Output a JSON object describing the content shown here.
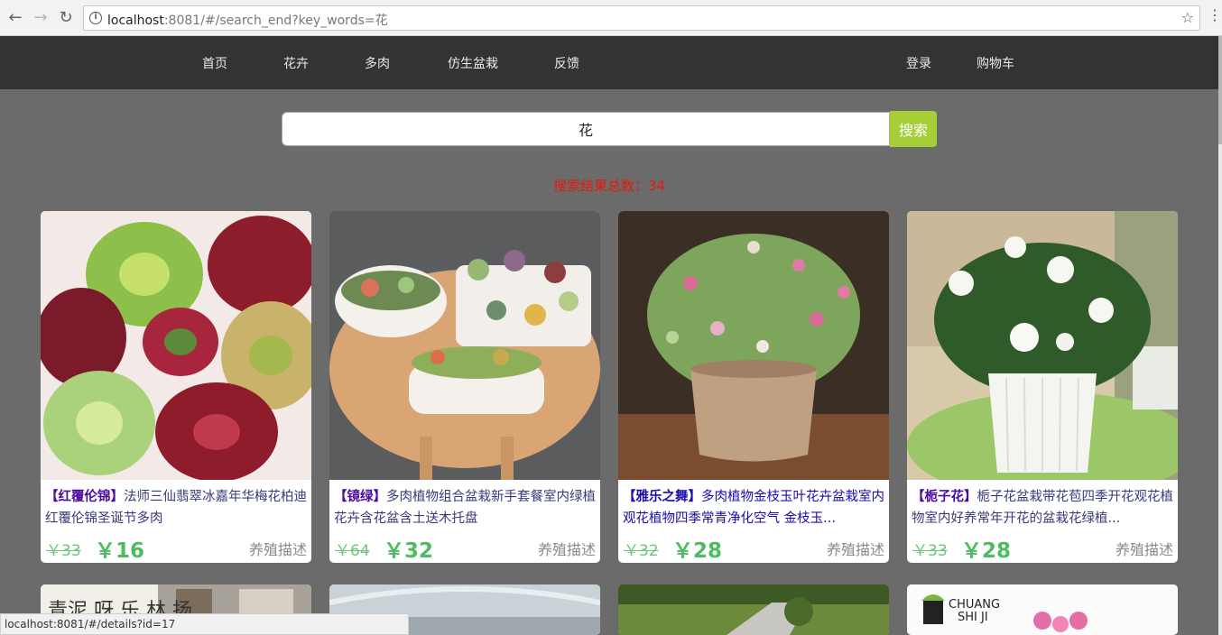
{
  "browser": {
    "url_host": "localhost",
    "url_rest": ":8081/#/search_end?key_words=花"
  },
  "nav": {
    "home": "首页",
    "flowers": "花卉",
    "succulents": "多肉",
    "artificial": "仿生盆栽",
    "feedback": "反馈",
    "login": "登录",
    "cart": "购物车"
  },
  "search": {
    "value": "花",
    "button": "搜索",
    "result_label": "搜索结果总数：34"
  },
  "products": [
    {
      "tag": "【红覆伦锦】",
      "title": "法师三仙翡翠冰嘉年华梅花柏迪红覆伦锦圣诞节多肉",
      "old_price": "￥33",
      "price": "￥16",
      "desc": "养殖描述"
    },
    {
      "tag": "【镜绿】",
      "title": "多肉植物组合盆栽新手套餐室内绿植花卉含花盆含土送木托盘",
      "old_price": "￥64",
      "price": "￥32",
      "desc": "养殖描述"
    },
    {
      "tag": "【雅乐之舞】",
      "title": "多肉植物金枝玉叶花卉盆栽室内观花植物四季常青净化空气 金枝玉...",
      "old_price": "￥32",
      "price": "￥28",
      "desc": "养殖描述"
    },
    {
      "tag": "【栀子花】",
      "title": "栀子花盆栽带花苞四季开花观花植物室内好养常年开花的盆栽花绿植...",
      "old_price": "￥33",
      "price": "￥28",
      "desc": "养殖描述"
    }
  ],
  "second_row_partial": {
    "card4_brand_line1": "CHUANG",
    "card4_brand_line2": "SHI JI"
  },
  "status_bar": "localhost:8081/#/details?id=17"
}
